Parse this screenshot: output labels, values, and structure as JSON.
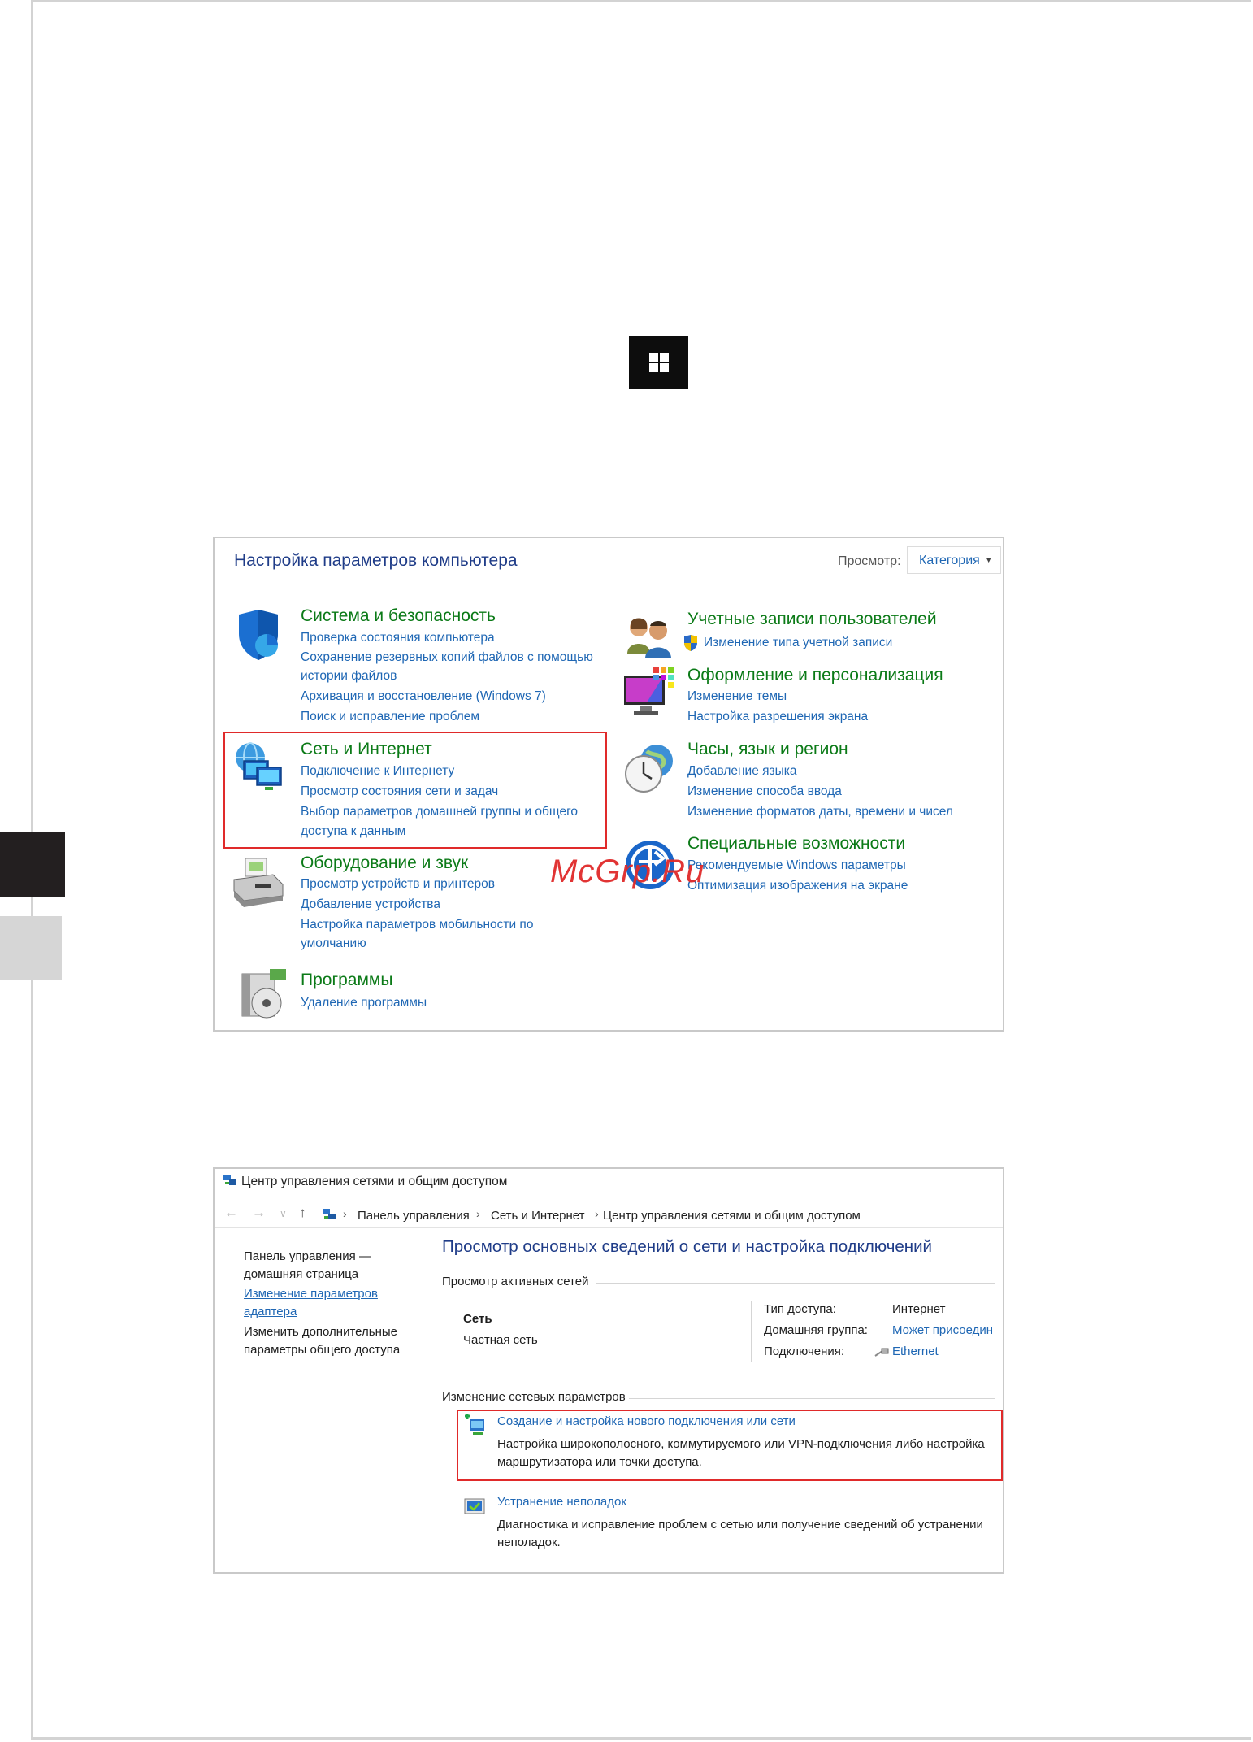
{
  "colors": {
    "link": "#1f67b4",
    "category_title": "#0b7a17",
    "heading": "#1f3c88",
    "highlight": "#e02a2a",
    "tab_dark": "#231f20",
    "tab_light": "#d6d6d6"
  },
  "windows_key": {
    "icon": "windows-logo-icon"
  },
  "control_panel": {
    "title": "Настройка параметров компьютера",
    "view_label": "Просмотр:",
    "view_value": "Категория",
    "left": [
      {
        "title": "Система и безопасность",
        "icon": "shield-icon",
        "links": [
          "Проверка состояния компьютера",
          "Сохранение резервных копий файлов с помощью",
          "истории файлов",
          "Архивация и восстановление (Windows 7)",
          "Поиск и исправление проблем"
        ]
      },
      {
        "title": "Сеть и Интернет",
        "icon": "network-globe-icon",
        "links": [
          "Подключение к Интернету",
          "Просмотр состояния сети и задач",
          "Выбор параметров домашней группы и общего",
          "доступа к данным"
        ]
      },
      {
        "title": "Оборудование и звук",
        "icon": "printer-icon",
        "links": [
          "Просмотр устройств и принтеров",
          "Добавление устройства",
          "Настройка параметров мобильности по",
          "умолчанию"
        ]
      },
      {
        "title": "Программы",
        "icon": "programs-disc-icon",
        "links": [
          "Удаление программы"
        ]
      }
    ],
    "right": [
      {
        "title": "Учетные записи пользователей",
        "icon": "users-icon",
        "links": [
          "Изменение типа учетной записи"
        ]
      },
      {
        "title": "Оформление и персонализация",
        "icon": "monitor-palette-icon",
        "links": [
          "Изменение темы",
          "Настройка разрешения экрана"
        ]
      },
      {
        "title": "Часы, язык и регион",
        "icon": "clock-globe-icon",
        "links": [
          "Добавление языка",
          "Изменение способа ввода",
          "Изменение форматов даты, времени и чисел"
        ]
      },
      {
        "title": "Специальные возможности",
        "icon": "accessibility-icon",
        "links": [
          "Рекомендуемые Windows параметры",
          "Оптимизация изображения на экране"
        ]
      }
    ],
    "watermark": "McGrp.Ru"
  },
  "network_center": {
    "window_title": "Центр управления сетями и общим доступом",
    "breadcrumb": [
      "Панель управления",
      "Сеть и Интернет",
      "Центр управления сетями и общим доступом"
    ],
    "sidebar": {
      "home_line1": "Панель управления —",
      "home_line2": "домашняя страница",
      "adapter_line1": "Изменение параметров",
      "adapter_line2": "адаптера",
      "sharing_line1": "Изменить дополнительные",
      "sharing_line2": "параметры общего доступа"
    },
    "heading": "Просмотр основных сведений о сети и настройка подключений",
    "active_networks_label": "Просмотр активных сетей",
    "network_name": "Сеть",
    "network_type": "Частная сеть",
    "access_type_label": "Тип доступа:",
    "access_type_value": "Интернет",
    "homegroup_label": "Домашняя группа:",
    "homegroup_value": "Может присоедин",
    "connections_label": "Подключения:",
    "connections_value": "Ethernet",
    "change_settings_label": "Изменение сетевых параметров",
    "new_connection_link": "Создание и настройка нового подключения или сети",
    "new_connection_desc1": "Настройка широкополосного, коммутируемого или VPN-подключения либо настройка",
    "new_connection_desc2": "маршрутизатора или точки доступа.",
    "troubleshoot_link": "Устранение неполадок",
    "troubleshoot_desc1": "Диагностика и исправление проблем с сетью или получение сведений об устранении",
    "troubleshoot_desc2": "неполадок."
  }
}
